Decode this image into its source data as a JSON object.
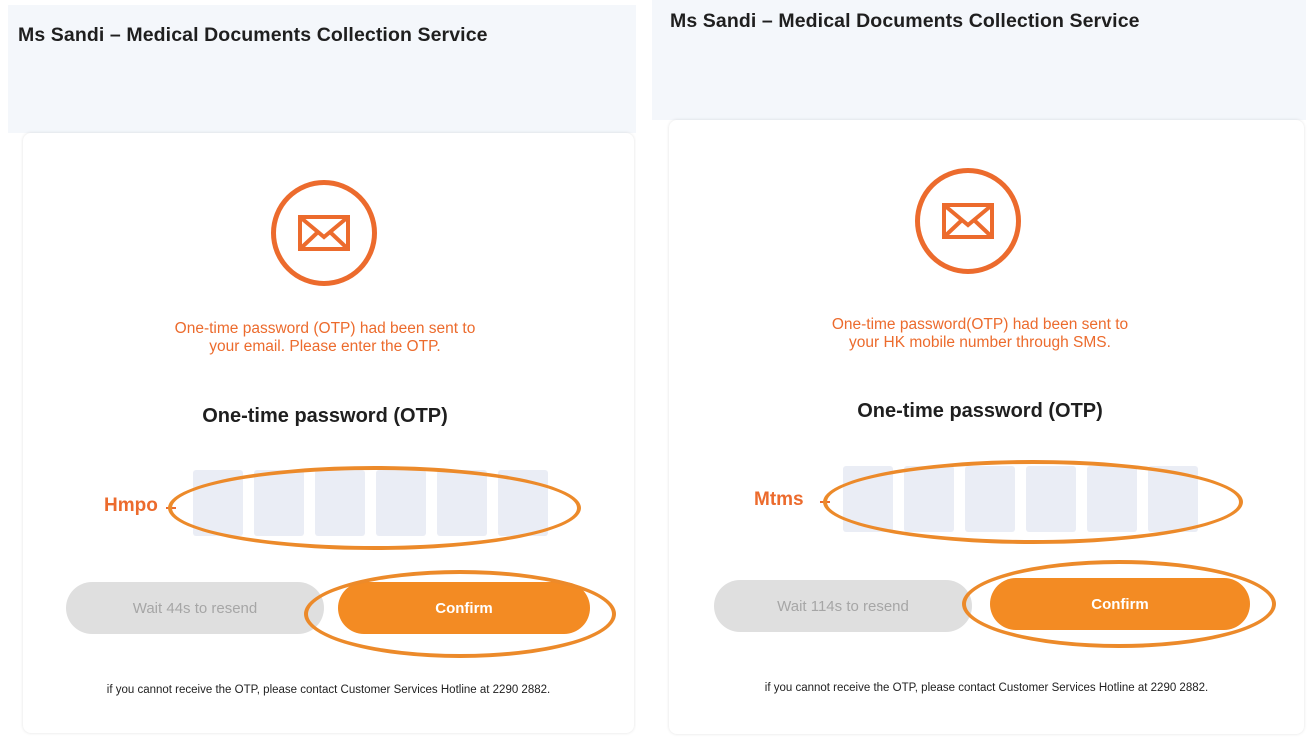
{
  "colors": {
    "accent": "#ec6b2d",
    "confirm_bg": "#f38b23",
    "otp_box_bg": "#eaedf5",
    "resend_bg": "#dfdfdf"
  },
  "panels": [
    {
      "title": "Ms Sandi – Medical Documents Collection Service",
      "icon": "envelope-icon",
      "message": "One-time password (OTP) had been sent to\nyour email. Please enter the OTP.",
      "otp_label": "One-time password (OTP)",
      "otp_prefix": "Hmpo",
      "otp_digits": [
        "",
        "",
        "",
        "",
        "",
        ""
      ],
      "resend_label": "Wait 44s to resend",
      "confirm_label": "Confirm",
      "hotline_note": "if you cannot receive the OTP, please contact Customer Services Hotline at 2290 2882."
    },
    {
      "title": "Ms Sandi – Medical Documents Collection Service",
      "icon": "envelope-icon",
      "message": "One-time password(OTP) had been sent to\nyour HK mobile number through SMS.",
      "otp_label": "One-time password (OTP)",
      "otp_prefix": "Mtms",
      "otp_digits": [
        "",
        "",
        "",
        "",
        "",
        ""
      ],
      "resend_label": "Wait 114s to resend",
      "confirm_label": "Confirm",
      "hotline_note": "if you cannot receive the OTP, please contact Customer Services Hotline at 2290 2882."
    }
  ]
}
